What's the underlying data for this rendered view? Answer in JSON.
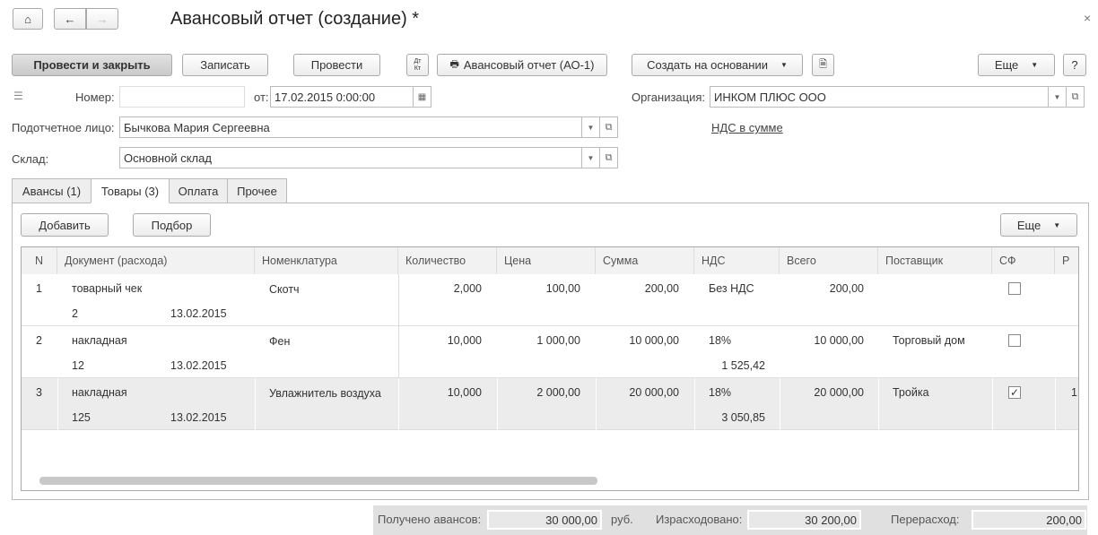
{
  "window": {
    "title": "Авансовый отчет (создание) *"
  },
  "toolbar": {
    "post_close": "Провести и закрыть",
    "save": "Записать",
    "post": "Провести",
    "dtkt": "Дт Кт",
    "print": "Авансовый отчет (АО-1)",
    "create_based": "Создать на основании",
    "more": "Еще",
    "help": "?"
  },
  "form": {
    "number_label": "Номер:",
    "number_value": "",
    "date_label": "от:",
    "date_value": "17.02.2015  0:00:00",
    "org_label": "Организация:",
    "org_value": "ИНКОМ ПЛЮС ООО",
    "person_label": "Подотчетное лицо:",
    "person_value": "Бычкова Мария Сергеевна",
    "vat_link": "НДС в сумме",
    "warehouse_label": "Склад:",
    "warehouse_value": "Основной склад"
  },
  "tabs": [
    {
      "label": "Авансы (1)"
    },
    {
      "label": "Товары (3)"
    },
    {
      "label": "Оплата"
    },
    {
      "label": "Прочее"
    }
  ],
  "table_toolbar": {
    "add": "Добавить",
    "pick": "Подбор",
    "more": "Еще"
  },
  "columns": [
    "N",
    "Документ (расхода)",
    "Номенклатура",
    "Количество",
    "Цена",
    "Сумма",
    "НДС",
    "Всего",
    "Поставщик",
    "СФ",
    "Р"
  ],
  "rows": [
    {
      "n": "1",
      "doc": "товарный чек",
      "doc_no": "2",
      "doc_date": "13.02.2015",
      "item": "Скотч",
      "qty": "2,000",
      "price": "100,00",
      "sum": "200,00",
      "vat_rate": "Без НДС",
      "vat_sum": "",
      "total": "200,00",
      "supplier": "",
      "sf": false,
      "r": ""
    },
    {
      "n": "2",
      "doc": "накладная",
      "doc_no": "12",
      "doc_date": "13.02.2015",
      "item": "Фен",
      "qty": "10,000",
      "price": "1 000,00",
      "sum": "10 000,00",
      "vat_rate": "18%",
      "vat_sum": "1 525,42",
      "total": "10 000,00",
      "supplier": "Торговый дом",
      "sf": false,
      "r": ""
    },
    {
      "n": "3",
      "doc": "накладная",
      "doc_no": "125",
      "doc_date": "13.02.2015",
      "item": "Увлажнитель воздуха",
      "qty": "10,000",
      "price": "2 000,00",
      "sum": "20 000,00",
      "vat_rate": "18%",
      "vat_sum": "3 050,85",
      "total": "20 000,00",
      "supplier": "Тройка",
      "sf": true,
      "r": "1"
    }
  ],
  "totals": {
    "received_label": "Получено авансов:",
    "received": "30 000,00",
    "currency": "руб.",
    "spent_label": "Израсходовано:",
    "spent": "30 200,00",
    "over_label": "Перерасход:",
    "over": "200,00"
  }
}
